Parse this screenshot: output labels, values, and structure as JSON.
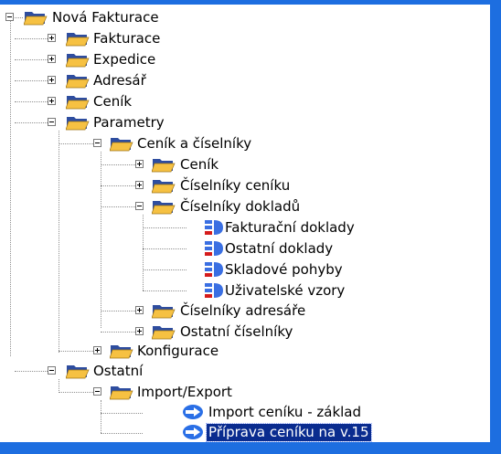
{
  "tree": {
    "root": {
      "label": "Nová Fakturace",
      "expanded": true
    },
    "fakturace": {
      "label": "Fakturace",
      "expanded": false
    },
    "expedice": {
      "label": "Expedice",
      "expanded": false
    },
    "adresar": {
      "label": "Adresář",
      "expanded": false
    },
    "cenik": {
      "label": "Ceník",
      "expanded": false
    },
    "parametry": {
      "label": "Parametry",
      "expanded": true
    },
    "cenik_a_ciselniky": {
      "label": "Ceník a číselníky",
      "expanded": true
    },
    "cenik_sub": {
      "label": "Ceník",
      "expanded": false
    },
    "ciselniky_ceniku": {
      "label": "Číselníky ceníku",
      "expanded": false
    },
    "ciselniky_dokladu": {
      "label": "Číselníky dokladů",
      "expanded": true
    },
    "fakturacni_doklady": {
      "label": "Fakturační doklady"
    },
    "ostatni_doklady": {
      "label": "Ostatní doklady"
    },
    "skladove_pohyby": {
      "label": "Skladové pohyby"
    },
    "uzivatelske_vzory": {
      "label": "Uživatelské vzory"
    },
    "ciselniky_adresare": {
      "label": "Číselníky adresáře",
      "expanded": false
    },
    "ostatni_ciselniky": {
      "label": "Ostatní číselníky",
      "expanded": false
    },
    "konfigurace": {
      "label": "Konfigurace",
      "expanded": false
    },
    "ostatni": {
      "label": "Ostatní",
      "expanded": true
    },
    "import_export": {
      "label": "Import/Export",
      "expanded": true
    },
    "import_ceniku": {
      "label": "Import ceníku - základ"
    },
    "priprava_ceniku": {
      "label": "Příprava ceníku na v.15",
      "selected": true
    }
  },
  "colors": {
    "window_frame": "#1d6ee0",
    "selection_bg": "#0a2c8f",
    "selection_text": "#ffffff",
    "folder_yellow": "#f6c142",
    "folder_dark": "#2e4d9f",
    "table_icon_blue": "#3a6fe2",
    "table_icon_red": "#d51c1c",
    "arrow_blue": "#2a6fe6"
  },
  "icons": {
    "expander_open": "minus-box-icon",
    "expander_closed": "plus-box-icon",
    "folder": "folder-open-icon",
    "table": "table-record-icon",
    "action": "blue-arrow-icon"
  }
}
